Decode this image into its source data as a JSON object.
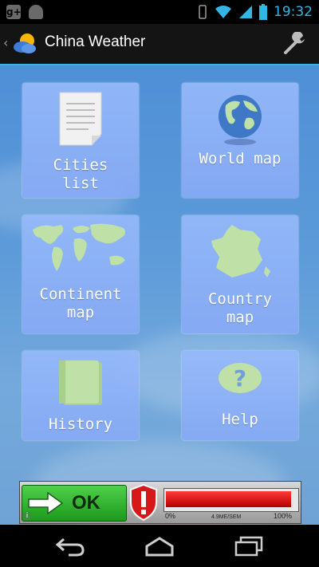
{
  "status_bar": {
    "time": "19:32",
    "left_icons": [
      "google-plus-icon",
      "android-icon"
    ],
    "right_icons": [
      "vibrate-icon",
      "wifi-icon",
      "signal-icon",
      "battery-icon"
    ],
    "accent": "#33b5e5"
  },
  "action_bar": {
    "title": "China Weather",
    "logo_icon": "weather-app-logo-icon",
    "settings_icon": "wrench-icon"
  },
  "tiles": [
    {
      "label": "Cities\nlist",
      "icon": "document-icon"
    },
    {
      "label": "World map",
      "icon": "globe-icon"
    },
    {
      "label": "Continent\nmap",
      "icon": "world-map-icon"
    },
    {
      "label": "Country\nmap",
      "icon": "france-map-icon"
    },
    {
      "label": "History",
      "icon": "book-icon"
    },
    {
      "label": "Help",
      "icon": "question-icon"
    }
  ],
  "ad": {
    "ok_label": "OK",
    "bar_min": "0%",
    "bar_max": "100%",
    "bar_fill_fraction": 0.97,
    "bar_caption": "4.9ME/SEM"
  },
  "navbar": {
    "icons": [
      "back-icon",
      "home-icon",
      "recent-apps-icon"
    ]
  }
}
